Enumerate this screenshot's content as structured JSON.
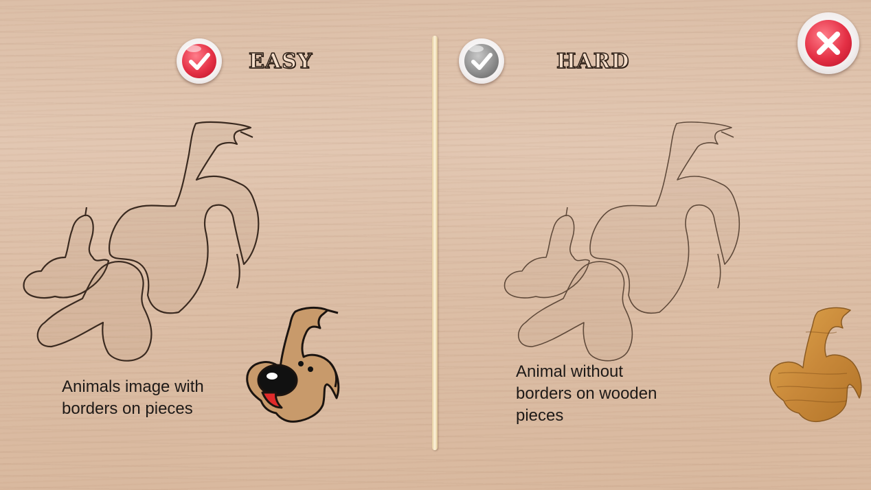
{
  "easy": {
    "label": "EASY",
    "selected": true,
    "description_line1": "Animals image with",
    "description_line2": "borders on pieces",
    "select_icon": "checkmark-icon",
    "thumbnail_icon": "cartoon-dog-icon"
  },
  "hard": {
    "label": "HARD",
    "selected": false,
    "description_line1": "Animal without",
    "description_line2": "borders on wooden",
    "description_line3": "pieces",
    "select_icon": "checkmark-icon",
    "thumbnail_icon": "wooden-dog-piece-icon"
  },
  "close_icon": "close-icon",
  "colors": {
    "selected": "#e43045",
    "unselected": "#8e8e8e",
    "wood": "#dcbfa8"
  }
}
